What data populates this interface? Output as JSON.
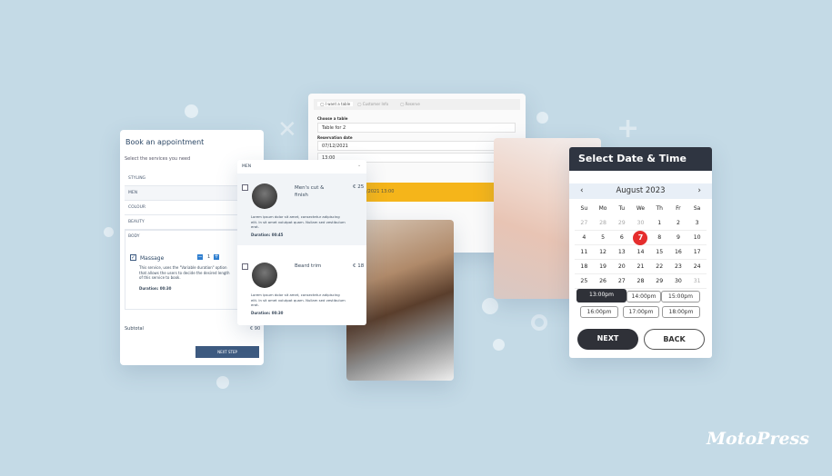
{
  "book": {
    "title": "Book an appointment",
    "subtitle": "Select the services you need",
    "categories": [
      "STYLING",
      "MEN",
      "COLOUR",
      "BEAUTY",
      "BODY"
    ],
    "service": {
      "name": "Massage",
      "qty": "1",
      "desc": "This service, uses the \"Variable duration\" option that allows the users to decide the desired length of this service to book.",
      "duration": "Duration: 00:30"
    },
    "subtotal_label": "Subtotal",
    "subtotal": "€ 90",
    "next": "NEXT STEP"
  },
  "services": {
    "dropdown": "MEN",
    "items": [
      {
        "name": "Men's cut & finish",
        "price": "€ 25",
        "desc": "Lorem ipsum dolor sit amet, consectetur adipiscing elit. In sit amet volutpat quam. Nullam sed vestibulum erat.",
        "duration": "Duration: 00:45"
      },
      {
        "name": "Beard trim",
        "price": "€ 18",
        "desc": "Lorem ipsum dolor sit amet, consectetur adipiscing elit. In sit amet volutpat quam. Nullam sed vestibulum erat.",
        "duration": "Duration: 00:30"
      }
    ]
  },
  "table": {
    "steps": [
      "I want a table",
      "Customer Info",
      "Reserve"
    ],
    "choose_label": "Choose a table",
    "table_value": "Table for 2",
    "date_label": "Reservation date",
    "date_value": "07/12/2021",
    "time_value": "13:00",
    "summary": "/2021 13:00"
  },
  "calendar": {
    "title": "Select Date & Time",
    "month": "August 2023",
    "weekdays": [
      "Su",
      "Mo",
      "Tu",
      "We",
      "Th",
      "Fr",
      "Sa"
    ],
    "days": [
      "27",
      "28",
      "29",
      "30",
      "1",
      "2",
      "3",
      "4",
      "5",
      "6",
      "7",
      "8",
      "9",
      "10",
      "11",
      "12",
      "13",
      "14",
      "15",
      "16",
      "17",
      "18",
      "19",
      "20",
      "21",
      "22",
      "23",
      "24",
      "25",
      "26",
      "27",
      "28",
      "29",
      "30",
      "31"
    ],
    "selected": "7",
    "slots": [
      "13:00pm",
      "14:00pm",
      "15:00pm",
      "16:00pm",
      "17:00pm",
      "18:00pm"
    ],
    "selected_slot": "13:00pm",
    "next": "NEXT",
    "back": "BACK",
    "accent": "#e52d2d"
  },
  "brand": "MotoPress"
}
